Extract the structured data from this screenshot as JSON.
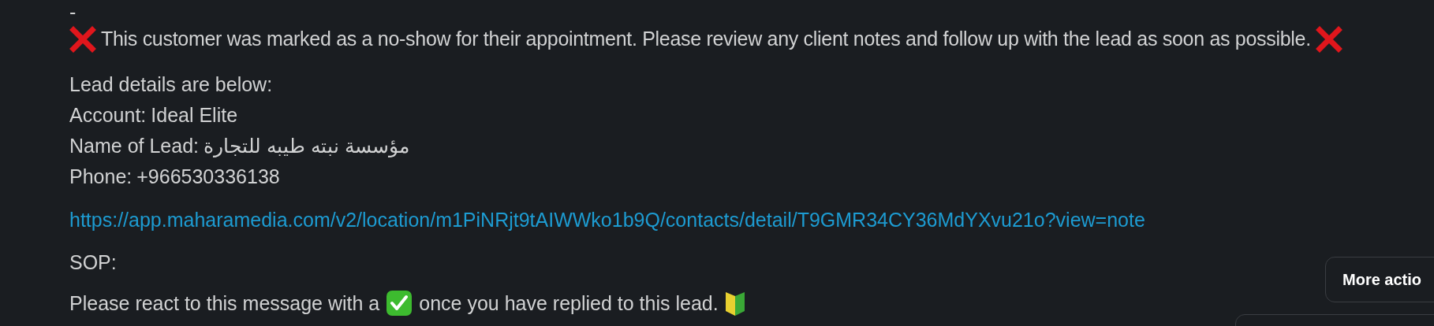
{
  "message": {
    "separator": "-",
    "alert": "This customer was marked as a no-show for their appointment. Please review any client notes and follow up with the lead as soon as possible.",
    "details_heading": "Lead details are below:",
    "fields": [
      {
        "label": "Account:",
        "value": "Ideal Elite"
      },
      {
        "label": "Name of Lead:",
        "value": "مؤسسة نبته طيبه للتجارة"
      },
      {
        "label": "Phone:",
        "value": "+966530336138"
      }
    ],
    "link": "https://app.maharamedia.com/v2/location/m1PiNRjt9tAIWWko1b9Q/contacts/detail/T9GMR34CY36MdYXvu21o?view=note",
    "sop_label": "SOP:",
    "instruction_before": "Please react to this message with a",
    "instruction_after": "once you have replied to this lead."
  },
  "more_actions_button": "More actio"
}
